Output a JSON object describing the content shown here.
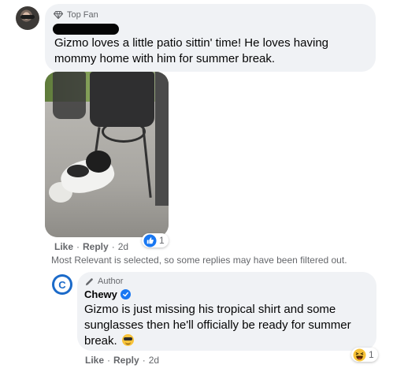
{
  "comment": {
    "badge": "Top Fan",
    "text": "Gizmo loves a little patio sittin' time! He loves having mommy home with him for summer break.",
    "actions": {
      "like": "Like",
      "reply": "Reply",
      "time": "2d",
      "separator": "·"
    },
    "reaction": {
      "type": "like",
      "count": "1"
    }
  },
  "filter_note": "Most Relevant is selected, so some replies may have been filtered out.",
  "reply": {
    "badge": "Author",
    "author_name": "Chewy",
    "avatar_letter": "C",
    "text": "Gizmo is just missing his tropical shirt and some sunglasses then he'll officially be ready for summer break.",
    "emoji": "smiling-face-with-sunglasses",
    "actions": {
      "like": "Like",
      "reply": "Reply",
      "time": "2d",
      "separator": "·"
    },
    "reaction": {
      "type": "haha",
      "count": "1"
    }
  },
  "colors": {
    "bubble": "#f0f2f5",
    "secondary_text": "#65676b",
    "like_blue": "#1877f2",
    "chewy_blue": "#1b6ac9"
  }
}
